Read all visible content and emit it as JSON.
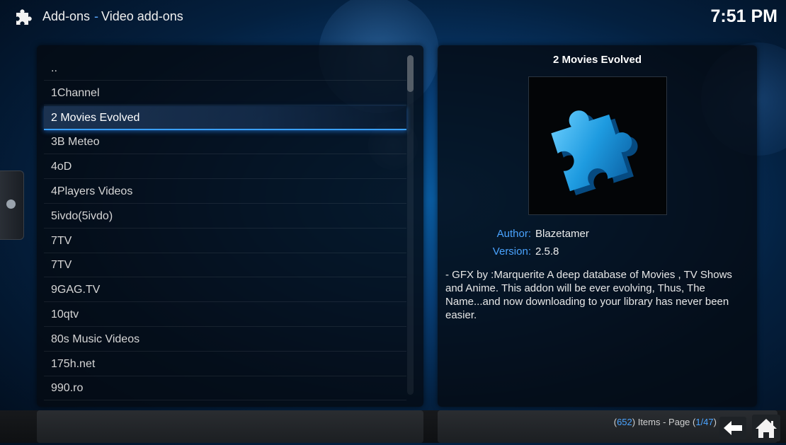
{
  "header": {
    "section": "Add-ons",
    "separator": "-",
    "subsection": "Video add-ons",
    "clock": "7:51 PM"
  },
  "list": {
    "items": [
      {
        "label": ".."
      },
      {
        "label": "1Channel"
      },
      {
        "label": "2 Movies Evolved",
        "selected": true
      },
      {
        "label": "3B Meteo"
      },
      {
        "label": "4oD"
      },
      {
        "label": "4Players Videos"
      },
      {
        "label": "5ivdo(5ivdo)"
      },
      {
        "label": "7TV"
      },
      {
        "label": "7TV"
      },
      {
        "label": "9GAG.TV"
      },
      {
        "label": "10qtv"
      },
      {
        "label": "80s Music Videos"
      },
      {
        "label": "175h.net"
      },
      {
        "label": "990.ro"
      }
    ]
  },
  "details": {
    "title": "2 Movies Evolved",
    "thumbnail_icon": "puzzle-piece-icon",
    "author_label": "Author:",
    "author_value": "Blazetamer",
    "version_label": "Version:",
    "version_value": "2.5.8",
    "description": "- GFX by :Marquerite  A deep database of Movies , TV Shows and Anime. This addon will be ever evolving, Thus, The Name...and now downloading to your library has never been easier."
  },
  "footer": {
    "count_open": "(",
    "item_count": "652",
    "count_text": ") Items - Page (",
    "page_current": "1/47",
    "page_close": ")"
  },
  "colors": {
    "accent": "#4aa3ff",
    "puzzle": "#1e9be0"
  }
}
